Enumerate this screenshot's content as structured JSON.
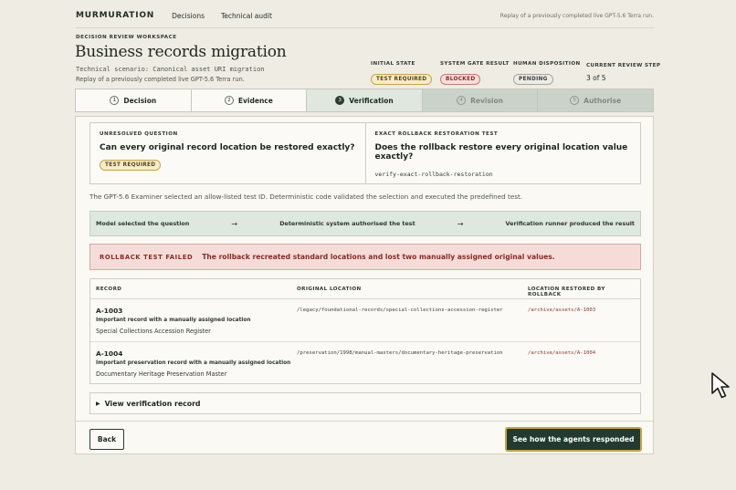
{
  "nav": {
    "brand": "MURMURATION",
    "links": [
      "Decisions",
      "Technical audit"
    ],
    "note": "Replay of a previously completed live GPT-5.6 Terra run."
  },
  "header": {
    "workspace": "DECISION REVIEW WORKSPACE",
    "title": "Business records migration",
    "scenario": "Technical scenario: Canonical asset URI migration",
    "replay": "Replay of a previously completed live GPT-5.6 Terra run."
  },
  "stats": {
    "initial_state": {
      "label": "INITIAL STATE",
      "value": "TEST REQUIRED"
    },
    "system_gate": {
      "label": "SYSTEM GATE RESULT",
      "value": "BLOCKED"
    },
    "human": {
      "label": "HUMAN DISPOSITION",
      "value": "PENDING"
    },
    "review_step": {
      "label": "CURRENT REVIEW STEP",
      "value": "3 of 5"
    }
  },
  "steps": [
    {
      "num": "1",
      "label": "Decision"
    },
    {
      "num": "2",
      "label": "Evidence"
    },
    {
      "num": "3",
      "label": "Verification"
    },
    {
      "num": "4",
      "label": "Revision"
    },
    {
      "num": "5",
      "label": "Authorise"
    }
  ],
  "question": {
    "left_label": "UNRESOLVED QUESTION",
    "left_title": "Can every original record location be restored exactly?",
    "left_pill": "TEST REQUIRED",
    "right_label": "EXACT ROLLBACK RESTORATION TEST",
    "right_title": "Does the rollback restore every original location value exactly?",
    "right_code": "verify-exact-rollback-restoration"
  },
  "examiner": "The GPT-5.6 Examiner selected an allow-listed test ID. Deterministic code validated the selection and executed the predefined test.",
  "flow": {
    "a": "Model selected the question",
    "b": "Deterministic system authorised the test",
    "c": "Verification runner produced the result",
    "arrow": "→"
  },
  "alert": {
    "label": "ROLLBACK TEST FAILED",
    "text": "The rollback recreated standard locations and lost two manually assigned original values."
  },
  "table": {
    "headers": [
      "RECORD",
      "ORIGINAL LOCATION",
      "LOCATION RESTORED BY ROLLBACK"
    ],
    "rows": [
      {
        "id": "A-1003",
        "desc": "Important record with a manually assigned location",
        "name": "Special Collections Accession Register",
        "original": "/legacy/foundational-records/special-collections-accession-register",
        "restored": "/archive/assets/A-1003"
      },
      {
        "id": "A-1004",
        "desc": "Important preservation record with a manually assigned location",
        "name": "Documentary Heritage Preservation Master",
        "original": "/preservation/1998/manual-masters/documentary-heritage-preservation",
        "restored": "/archive/assets/A-1004"
      }
    ]
  },
  "details": {
    "marker": "▶",
    "label": "View verification record"
  },
  "buttons": {
    "back": "Back",
    "primary": "See how the agents responded"
  },
  "colors": {
    "background": "#efece3",
    "primary_button": "#233a31",
    "accent_gold": "#c8a145",
    "alert_bg": "#f5dcd8",
    "alert_text": "#8a2b24",
    "flow_bg": "#dfe8df"
  }
}
